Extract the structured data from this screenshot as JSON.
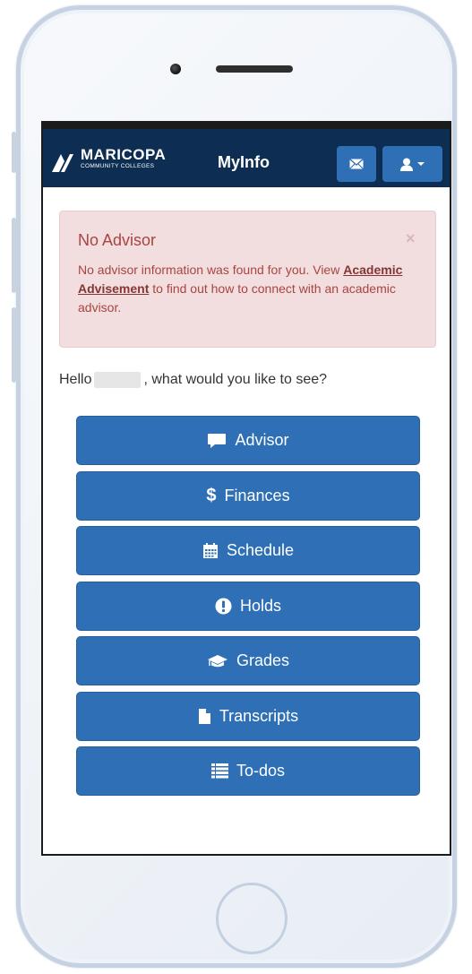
{
  "header": {
    "logo_name": "MARICOPA",
    "logo_sub": "COMMUNITY COLLEGES",
    "app_title": "MyInfo",
    "mail_icon": "envelope-icon",
    "user_icon": "user-icon"
  },
  "alert": {
    "title": "No Advisor",
    "close": "×",
    "text_before": "No advisor information was found for you. View ",
    "link": "Academic Advisement",
    "text_after": " to find out how to connect with an academic advisor."
  },
  "greeting": {
    "prefix": "Hello",
    "suffix": ", what would you like to see?"
  },
  "menu": [
    {
      "label": "Advisor",
      "icon": "comment-icon"
    },
    {
      "label": "Finances",
      "icon": "dollar-icon"
    },
    {
      "label": "Schedule",
      "icon": "calendar-icon"
    },
    {
      "label": "Holds",
      "icon": "exclamation-circle-icon"
    },
    {
      "label": "Grades",
      "icon": "graduation-cap-icon"
    },
    {
      "label": "Transcripts",
      "icon": "file-icon"
    },
    {
      "label": "To-dos",
      "icon": "list-icon"
    }
  ],
  "colors": {
    "navbar": "#0d2d52",
    "button": "#2e6fb5",
    "alert_bg": "#f2dede",
    "alert_text": "#a94442"
  }
}
